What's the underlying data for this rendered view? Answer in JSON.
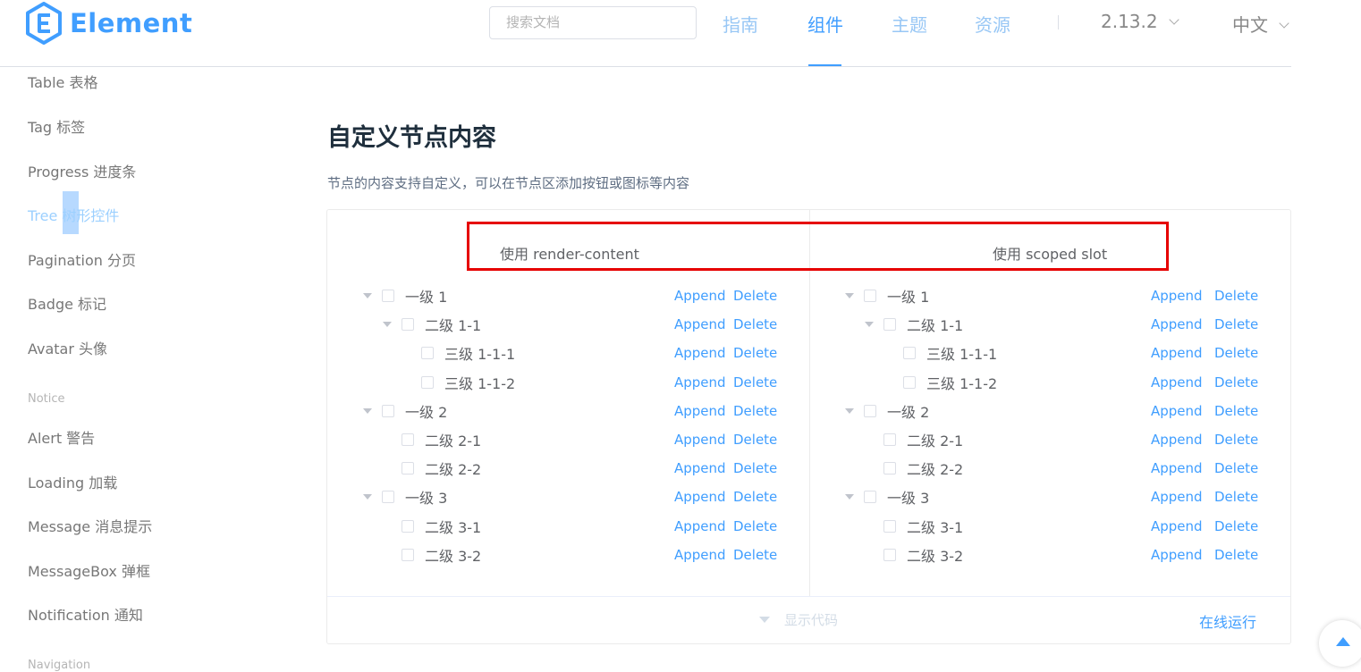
{
  "header": {
    "logo_text": "Element",
    "search_placeholder": "搜索文档",
    "nav": [
      "指南",
      "组件",
      "主题",
      "资源"
    ],
    "active_nav": "组件",
    "version": "2.13.2",
    "language": "中文"
  },
  "sidebar": {
    "items": [
      "Table 表格",
      "Tag 标签",
      "Progress 进度条",
      "Tree 树形控件",
      "Pagination 分页",
      "Badge 标记",
      "Avatar 头像",
      "Alert 警告",
      "Loading 加载",
      "Message 消息提示",
      "MessageBox 弹框",
      "Notification 通知"
    ],
    "active_item": "Tree 树形控件",
    "groups": [
      "Notice",
      "Navigation"
    ]
  },
  "main": {
    "title": "自定义节点内容",
    "description": "节点的内容支持自定义，可以在节点区添加按钮或图标等内容",
    "left_heading": "使用 render-content",
    "right_heading": "使用 scoped slot",
    "append_label": "Append",
    "delete_label": "Delete",
    "tree_nodes": [
      {
        "label": "一级 1",
        "level": 1,
        "expanded": true
      },
      {
        "label": "二级 1-1",
        "level": 2,
        "expanded": true
      },
      {
        "label": "三级 1-1-1",
        "level": 3
      },
      {
        "label": "三级 1-1-2",
        "level": 3
      },
      {
        "label": "一级 2",
        "level": 1,
        "expanded": true
      },
      {
        "label": "二级 2-1",
        "level": 2
      },
      {
        "label": "二级 2-2",
        "level": 2
      },
      {
        "label": "一级 3",
        "level": 1,
        "expanded": true
      },
      {
        "label": "二级 3-1",
        "level": 2
      },
      {
        "label": "二级 3-2",
        "level": 2
      }
    ],
    "show_code": "显示代码",
    "run_online": "在线运行"
  },
  "colors": {
    "accent": "#409eff",
    "highlight_box": "#e60000"
  }
}
